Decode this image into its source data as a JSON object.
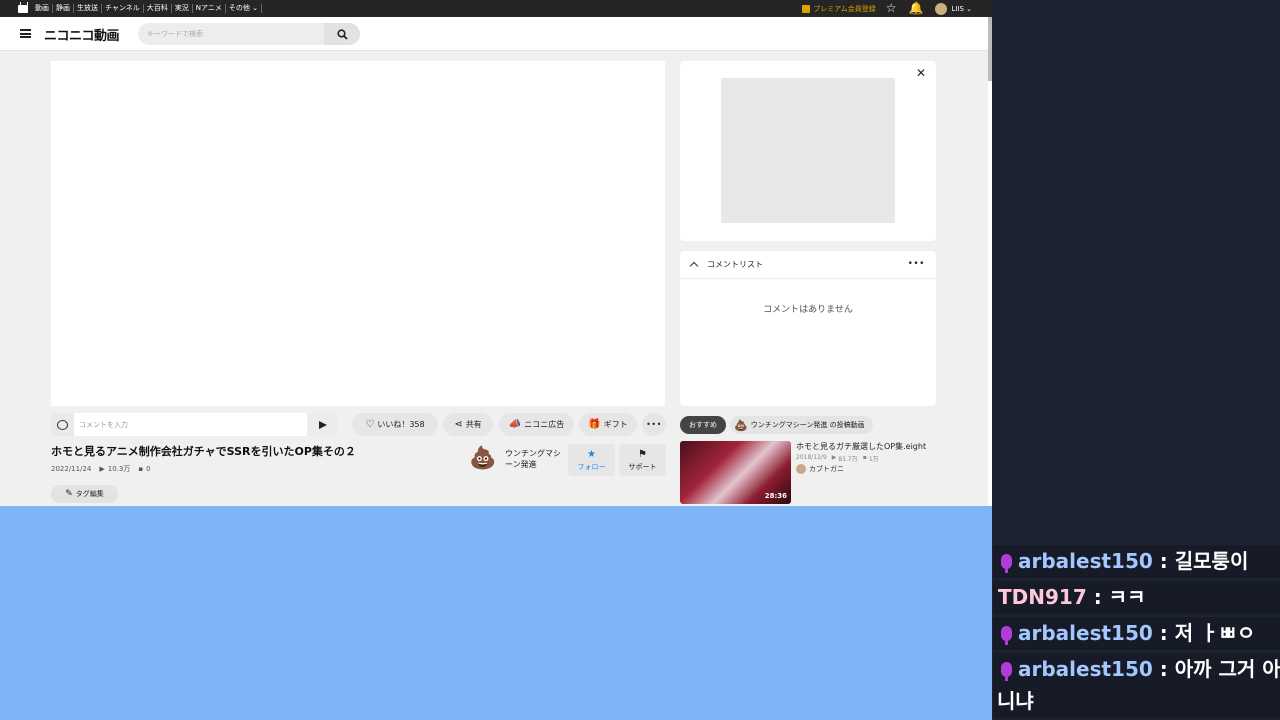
{
  "topbar": {
    "nav": [
      "動画",
      "静画",
      "生放送",
      "チャンネル",
      "大百科",
      "実況",
      "Nアニメ",
      "その他 ⌄"
    ],
    "premium_label": "プレミアム会員登録",
    "user_name": "LIIS ⌄"
  },
  "header": {
    "logo": "ニコニコ動画",
    "search_placeholder": "キーワードで検索"
  },
  "comment_panel": {
    "title": "コメントリスト",
    "empty": "コメントはありません"
  },
  "actions": {
    "comment_placeholder": "コメントを入力",
    "like": "いいね！358",
    "share": "共有",
    "ad": "ニコニ広告",
    "gift": "ギフト"
  },
  "video": {
    "title": "ホモと見るアニメ制作会社ガチャでSSRを引いたOP集その２",
    "date": "2022/11/24",
    "views": "10.3万",
    "comments": "0",
    "tag_edit": "タグ編集"
  },
  "owner": {
    "name": "ウンチングマシーン発進",
    "follow": "フォロー",
    "support": "サポート"
  },
  "recommend": {
    "tab_active": "おすすめ",
    "tab_other": "ウンチングマシーン発進 の投稿動画",
    "item": {
      "title": "ホモと見るガチ厳選したOP集.eight",
      "date": "2018/12/9",
      "views": "81.7万",
      "comments": "1万",
      "owner": "カブトガニ",
      "duration": "28:36"
    }
  },
  "chat": [
    {
      "nick": "arbalest150",
      "msg": "길모퉁이",
      "mic": true
    },
    {
      "nick": "TDN917",
      "msg": "ㅋㅋ",
      "mic": false
    },
    {
      "nick": "arbalest150",
      "msg": "저 ㅏㅃㅇ",
      "mic": true
    },
    {
      "nick": "arbalest150",
      "msg": "아까 그거 아",
      "mic": true,
      "cont": "니냐"
    }
  ],
  "colors": {
    "chroma_blue": "#7fb5f7",
    "follow_blue": "#1e88e5",
    "premium_gold": "#d9a400",
    "mic_purple": "#b13bd6"
  }
}
